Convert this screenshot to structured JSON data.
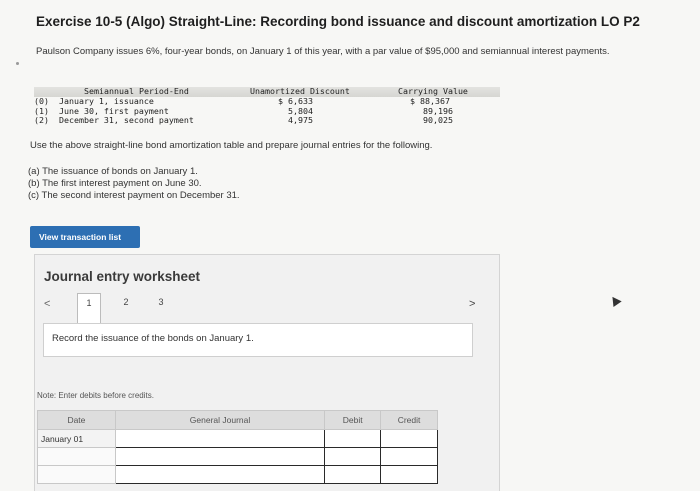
{
  "title": "Exercise 10-5 (Algo) Straight-Line: Recording bond issuance and discount amortization LO P2",
  "problem_text": "Paulson Company issues 6%, four-year bonds, on January 1 of this year, with a par value of $95,000 and semiannual interest payments.",
  "amortization": {
    "headers": [
      "Semiannual Period-End",
      "Unamortized Discount",
      "Carrying Value"
    ],
    "rows": [
      {
        "period": "(0)  January 1, issuance",
        "discount": "$ 6,633",
        "carrying": "$ 88,367"
      },
      {
        "period": "(1)  June 30, first payment",
        "discount": "5,804",
        "carrying": "89,196"
      },
      {
        "period": "(2)  December 31, second payment",
        "discount": "4,975",
        "carrying": "90,025"
      }
    ]
  },
  "instructions": "Use the above straight-line bond amortization table and prepare journal entries for the following.",
  "parts": [
    "(a) The issuance of bonds on January 1.",
    "(b) The first interest payment on June 30.",
    "(c) The second interest payment on December 31."
  ],
  "view_transaction_label": "View transaction list",
  "worksheet": {
    "title": "Journal entry worksheet",
    "prev": "<",
    "next": ">",
    "tabs": [
      "1",
      "2",
      "3"
    ],
    "record_text": "Record the issuance of the bonds on January 1.",
    "note": "Note: Enter debits before credits.",
    "columns": [
      "Date",
      "General Journal",
      "Debit",
      "Credit"
    ],
    "first_date": "January 01"
  }
}
